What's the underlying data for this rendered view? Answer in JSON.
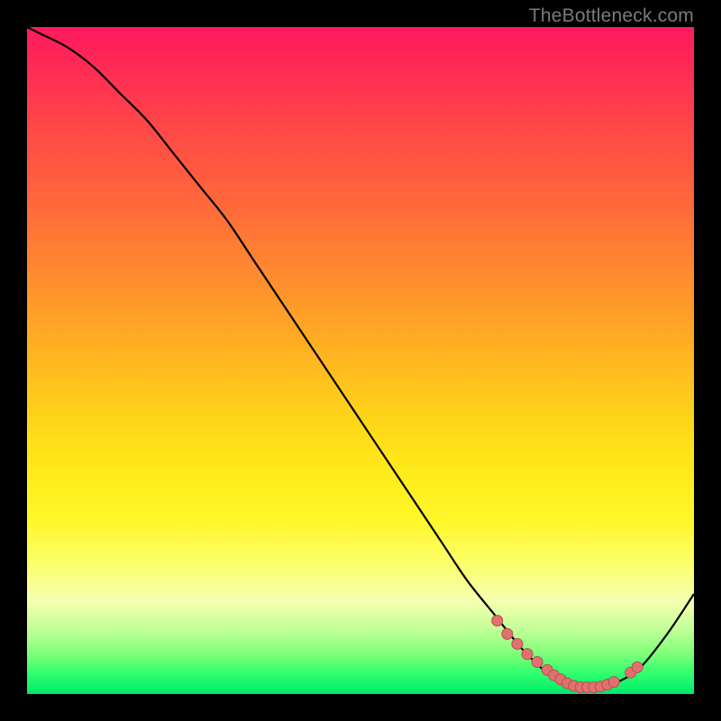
{
  "watermark": {
    "text": "TheBottleneck.com"
  },
  "colors": {
    "frame": "#000000",
    "curve_stroke": "#000000",
    "marker_fill": "#e2706e",
    "marker_stroke": "#b5504f"
  },
  "chart_data": {
    "type": "line",
    "title": "",
    "xlabel": "",
    "ylabel": "",
    "xlim": [
      0,
      100
    ],
    "ylim": [
      0,
      100
    ],
    "grid": false,
    "series": [
      {
        "name": "curve",
        "x": [
          0,
          2,
          6,
          10,
          14,
          18,
          22,
          26,
          30,
          34,
          38,
          42,
          46,
          50,
          54,
          58,
          62,
          66,
          70,
          74,
          77,
          79,
          81,
          83,
          85,
          87,
          89,
          92,
          96,
          100
        ],
        "y": [
          100,
          99,
          97,
          94,
          90,
          86,
          81,
          76,
          71,
          65,
          59,
          53,
          47,
          41,
          35,
          29,
          23,
          17,
          12,
          7,
          4,
          2.5,
          1.5,
          1,
          1,
          1.3,
          2,
          4,
          9,
          15
        ]
      }
    ],
    "markers": [
      {
        "x": 70.5,
        "y": 11
      },
      {
        "x": 72.0,
        "y": 9
      },
      {
        "x": 73.5,
        "y": 7.5
      },
      {
        "x": 75.0,
        "y": 6
      },
      {
        "x": 76.5,
        "y": 4.8
      },
      {
        "x": 78.0,
        "y": 3.6
      },
      {
        "x": 79.0,
        "y": 2.8
      },
      {
        "x": 80.0,
        "y": 2.2
      },
      {
        "x": 81.0,
        "y": 1.6
      },
      {
        "x": 82.0,
        "y": 1.2
      },
      {
        "x": 83.0,
        "y": 1.0
      },
      {
        "x": 84.0,
        "y": 1.0
      },
      {
        "x": 85.0,
        "y": 1.0
      },
      {
        "x": 86.0,
        "y": 1.1
      },
      {
        "x": 87.0,
        "y": 1.4
      },
      {
        "x": 88.0,
        "y": 1.8
      },
      {
        "x": 90.5,
        "y": 3.2
      },
      {
        "x": 91.5,
        "y": 4.0
      }
    ]
  }
}
